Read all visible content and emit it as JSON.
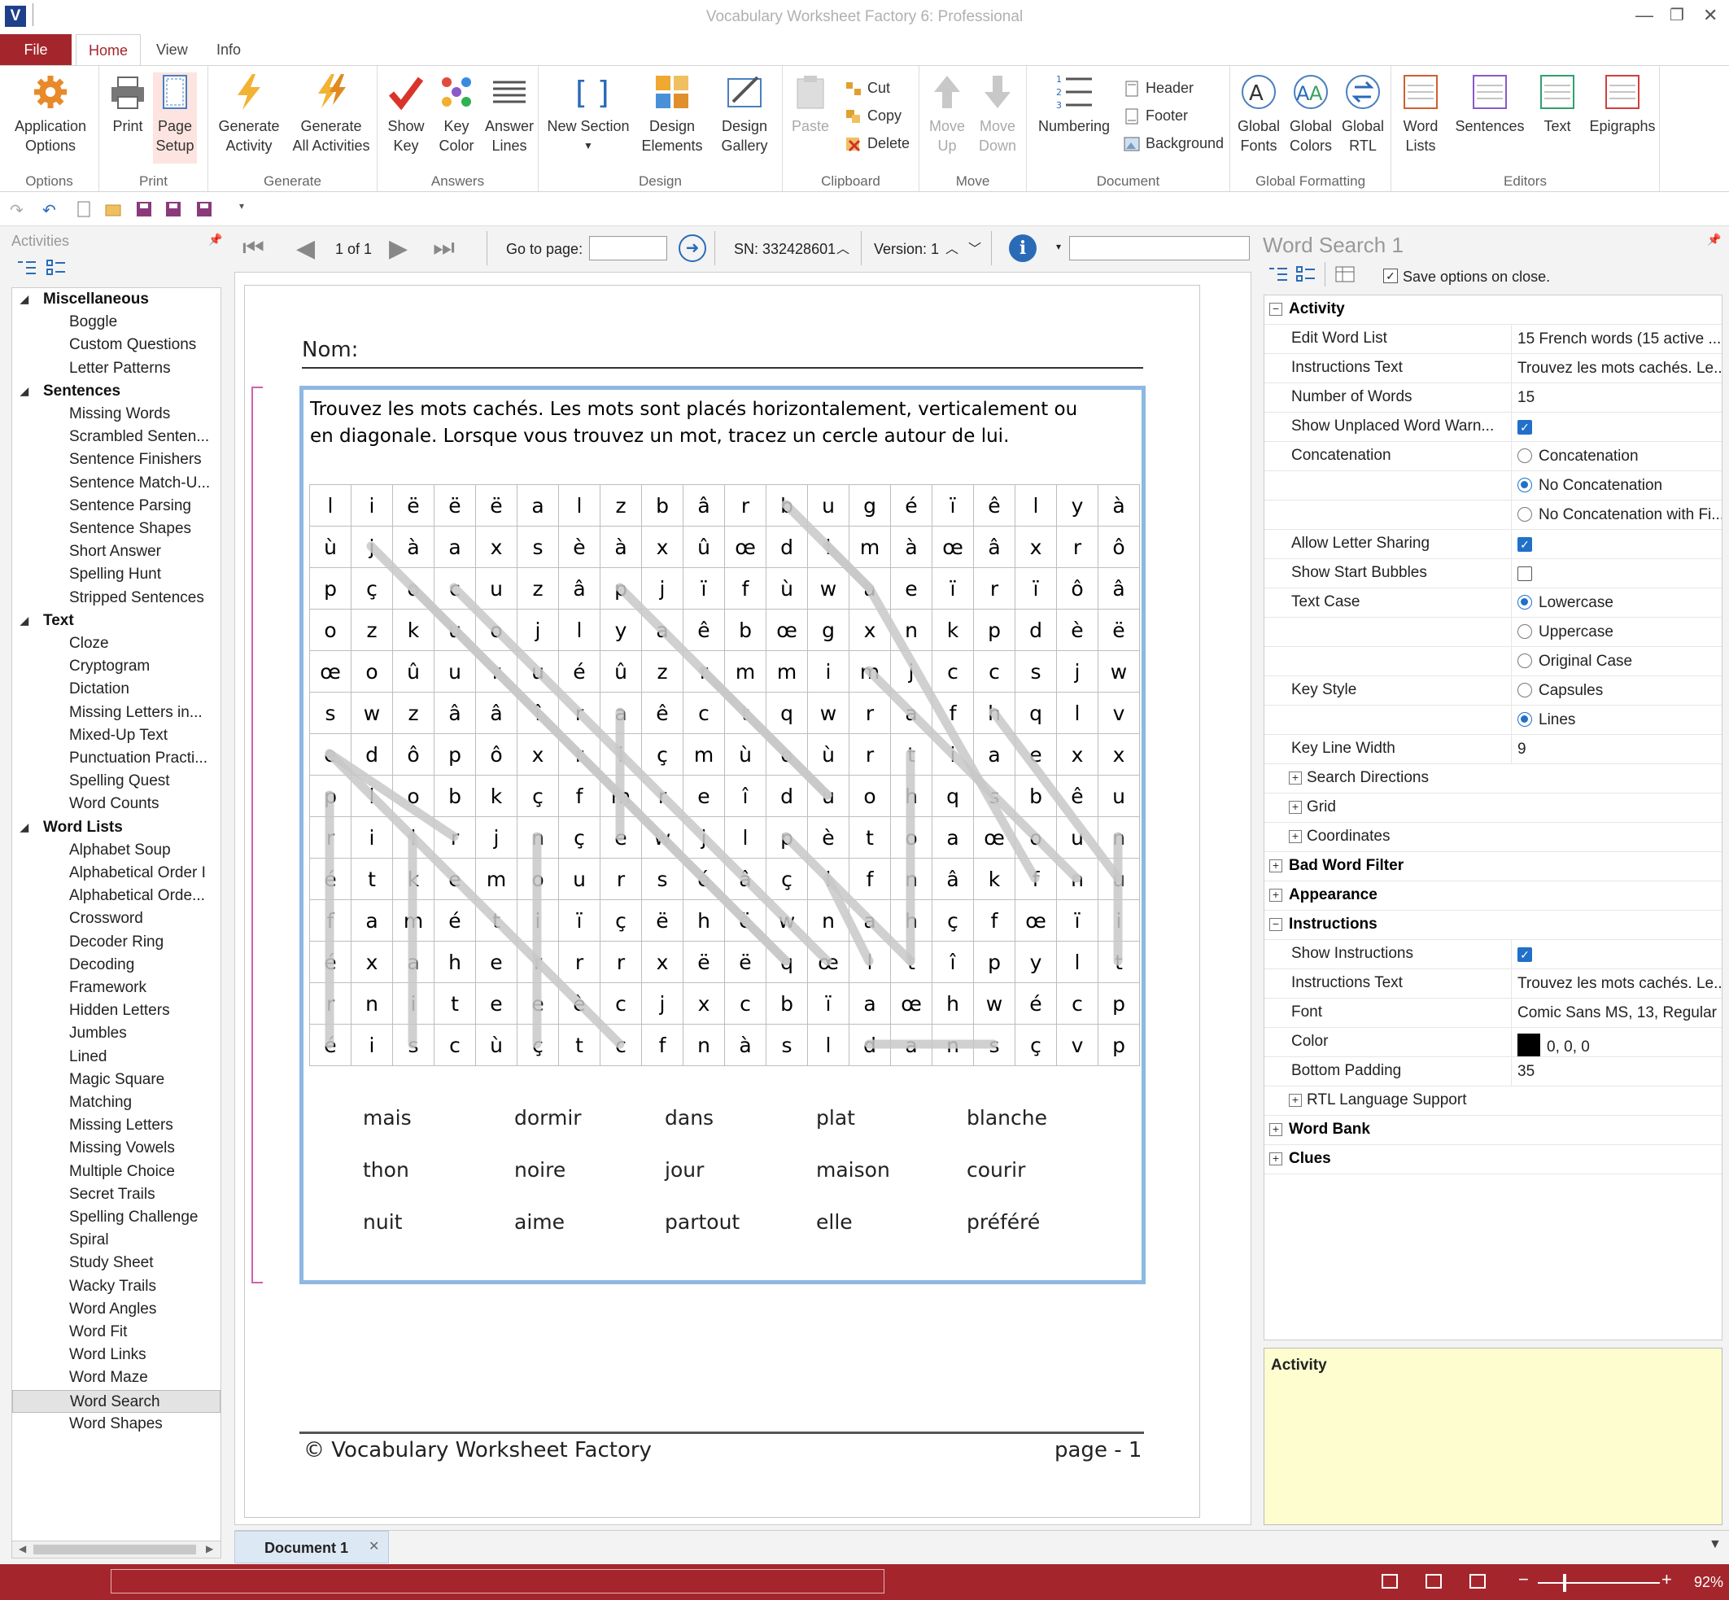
{
  "app": {
    "title": "Vocabulary Worksheet Factory 6: Professional",
    "logo": "V"
  },
  "tabs": [
    "File",
    "Home",
    "View",
    "Info"
  ],
  "ribbon": {
    "groups": [
      "Options",
      "Print",
      "Generate",
      "Answers",
      "Design",
      "Clipboard",
      "Move",
      "Document",
      "Global Formatting",
      "Editors"
    ],
    "buttons": {
      "application_options": "Application\nOptions",
      "print": "Print",
      "page_setup": "Page\nSetup",
      "generate_activity": "Generate\nActivity",
      "generate_all": "Generate\nAll Activities",
      "show_key": "Show\nKey",
      "key_color": "Key\nColor",
      "answer_lines": "Answer\nLines",
      "new_section": "New Section",
      "design_elements": "Design\nElements",
      "design_gallery": "Design\nGallery",
      "paste": "Paste",
      "cut": "Cut",
      "copy": "Copy",
      "delete": "Delete",
      "move_up": "Move\nUp",
      "move_down": "Move\nDown",
      "numbering": "Numbering",
      "header": "Header",
      "footer": "Footer",
      "background": "Background",
      "global_fonts": "Global\nFonts",
      "global_colors": "Global\nColors",
      "global_rtl": "Global\nRTL",
      "word_lists": "Word\nLists",
      "sentences": "Sentences",
      "text": "Text",
      "epigraphs": "Epigraphs"
    }
  },
  "left_panel": {
    "title": "Activities",
    "tree": [
      {
        "cat": "Miscellaneous",
        "items": [
          "Boggle",
          "Custom Questions",
          "Letter Patterns"
        ]
      },
      {
        "cat": "Sentences",
        "items": [
          "Missing Words",
          "Scrambled Senten...",
          "Sentence Finishers",
          "Sentence  Match-U...",
          "Sentence Parsing",
          "Sentence Shapes",
          "Short Answer",
          "Spelling Hunt",
          "Stripped Sentences"
        ]
      },
      {
        "cat": "Text",
        "items": [
          "Cloze",
          "Cryptogram",
          "Dictation",
          "Missing Letters in...",
          "Mixed-Up Text",
          "Punctuation  Practi...",
          "Spelling Quest",
          "Word Counts"
        ]
      },
      {
        "cat": "Word Lists",
        "items": [
          "Alphabet Soup",
          "Alphabetical Order I",
          "Alphabetical Orde...",
          "Crossword",
          "Decoder Ring",
          "Decoding",
          "Framework",
          "Hidden Letters",
          "Jumbles",
          "Lined",
          "Magic Square",
          "Matching",
          "Missing Letters",
          "Missing Vowels",
          "Multiple Choice",
          "Secret Trails",
          "Spelling Challenge",
          "Spiral",
          "Study Sheet",
          "Wacky Trails",
          "Word Angles",
          "Word Fit",
          "Word Links",
          "Word Maze",
          "Word Search",
          "Word Shapes"
        ]
      }
    ],
    "selected": "Word Search"
  },
  "doc_toolbar": {
    "page": "1 of 1",
    "goto_label": "Go to page:",
    "goto_value": "",
    "serial": "SN: 332428601",
    "version": "Version: 1"
  },
  "worksheet": {
    "name_label": "Nom:",
    "instructions": "Trouvez les mots cachés. Les mots sont placés horizontalement, verticalement ou en diagonale. Lorsque vous trouvez un mot, tracez un cercle autour de lui.",
    "grid": [
      [
        "l",
        "i",
        "ë",
        "ë",
        "ë",
        "a",
        "l",
        "z",
        "b",
        "â",
        "r",
        "b",
        "u",
        "g",
        "é",
        "ï",
        "ê",
        "l",
        "y",
        "à"
      ],
      [
        "ù",
        "j",
        "à",
        "a",
        "x",
        "s",
        "è",
        "à",
        "x",
        "û",
        "œ",
        "d",
        "l",
        "m",
        "à",
        "œ",
        "â",
        "x",
        "r",
        "ô"
      ],
      [
        "p",
        "ç",
        "o",
        "c",
        "u",
        "z",
        "â",
        "p",
        "j",
        "ï",
        "f",
        "ù",
        "w",
        "a",
        "e",
        "ï",
        "r",
        "ï",
        "ô",
        "â"
      ],
      [
        "o",
        "z",
        "k",
        "u",
        "o",
        "j",
        "l",
        "y",
        "a",
        "ê",
        "b",
        "œ",
        "g",
        "x",
        "n",
        "k",
        "p",
        "d",
        "è",
        "ë"
      ],
      [
        "œ",
        "o",
        "û",
        "u",
        "r",
        "u",
        "é",
        "û",
        "z",
        "r",
        "m",
        "m",
        "i",
        "m",
        "j",
        "c",
        "c",
        "s",
        "j",
        "w"
      ],
      [
        "s",
        "w",
        "z",
        "â",
        "â",
        "î",
        "r",
        "a",
        "ê",
        "c",
        "t",
        "q",
        "w",
        "r",
        "a",
        "f",
        "h",
        "q",
        "l",
        "v"
      ],
      [
        "e",
        "d",
        "ô",
        "p",
        "ô",
        "x",
        "r",
        "i",
        "ç",
        "m",
        "ù",
        "o",
        "ù",
        "r",
        "t",
        "i",
        "a",
        "e",
        "x",
        "x"
      ],
      [
        "p",
        "l",
        "o",
        "b",
        "k",
        "ç",
        "f",
        "m",
        "r",
        "e",
        "î",
        "d",
        "u",
        "o",
        "h",
        "q",
        "s",
        "b",
        "ê",
        "u"
      ],
      [
        "r",
        "i",
        "l",
        "r",
        "j",
        "n",
        "ç",
        "e",
        "w",
        "j",
        "l",
        "p",
        "è",
        "t",
        "o",
        "a",
        "œ",
        "o",
        "u",
        "n"
      ],
      [
        "é",
        "t",
        "k",
        "e",
        "m",
        "o",
        "u",
        "r",
        "s",
        "é",
        "â",
        "ç",
        "l",
        "f",
        "n",
        "â",
        "k",
        "f",
        "n",
        "u"
      ],
      [
        "f",
        "a",
        "m",
        "é",
        "t",
        "i",
        "ï",
        "ç",
        "ë",
        "h",
        "ë",
        "w",
        "n",
        "a",
        "h",
        "ç",
        "f",
        "œ",
        "ï",
        "i"
      ],
      [
        "é",
        "x",
        "a",
        "h",
        "e",
        "r",
        "r",
        "r",
        "x",
        "ë",
        "ë",
        "q",
        "œ",
        "l",
        "t",
        "î",
        "p",
        "y",
        "l",
        "t"
      ],
      [
        "r",
        "n",
        "i",
        "t",
        "e",
        "e",
        "è",
        "c",
        "j",
        "x",
        "c",
        "b",
        "ï",
        "a",
        "œ",
        "h",
        "w",
        "é",
        "c",
        "p"
      ],
      [
        "é",
        "i",
        "s",
        "c",
        "ù",
        "ç",
        "t",
        "c",
        "f",
        "n",
        "à",
        "s",
        "l",
        "d",
        "a",
        "n",
        "s",
        "ç",
        "v",
        "p"
      ]
    ],
    "word_bank": [
      [
        "mais",
        "dormir",
        "dans",
        "plat",
        "blanche"
      ],
      [
        "thon",
        "noire",
        "jour",
        "maison",
        "courir"
      ],
      [
        "nuit",
        "aime",
        "partout",
        "elle",
        "préféré"
      ]
    ],
    "footer_left": "© Vocabulary Worksheet Factory",
    "footer_right": "page - 1"
  },
  "right_panel": {
    "title": "Word Search 1",
    "save_option": "Save options on close.",
    "rows": [
      {
        "t": "sec",
        "label": "Activity",
        "exp": "−"
      },
      {
        "t": "val",
        "label": "Edit Word List",
        "value": "15 French words (15 active ..."
      },
      {
        "t": "val",
        "label": "Instructions Text",
        "value": "Trouvez les mots cachés. Le..."
      },
      {
        "t": "val",
        "label": "Number of Words",
        "value": "15"
      },
      {
        "t": "chk",
        "label": "Show Unplaced Word Warn...",
        "on": true
      },
      {
        "t": "rad",
        "label": "Concatenation",
        "value": "Concatenation",
        "on": false
      },
      {
        "t": "rad",
        "label": "",
        "value": "No Concatenation",
        "on": true
      },
      {
        "t": "rad",
        "label": "",
        "value": "No Concatenation with Fi...",
        "on": false
      },
      {
        "t": "chk",
        "label": "Allow Letter Sharing",
        "on": true
      },
      {
        "t": "chk",
        "label": "Show Start Bubbles",
        "on": false
      },
      {
        "t": "rad",
        "label": "Text Case",
        "value": "Lowercase",
        "on": true
      },
      {
        "t": "rad",
        "label": "",
        "value": "Uppercase",
        "on": false
      },
      {
        "t": "rad",
        "label": "",
        "value": "Original Case",
        "on": false
      },
      {
        "t": "rad",
        "label": "Key Style",
        "value": "Capsules",
        "on": false
      },
      {
        "t": "rad",
        "label": "",
        "value": "Lines",
        "on": true
      },
      {
        "t": "val",
        "label": "Key Line Width",
        "value": "9"
      },
      {
        "t": "sub",
        "label": "Search Directions"
      },
      {
        "t": "sub",
        "label": "Grid"
      },
      {
        "t": "sub",
        "label": "Coordinates"
      },
      {
        "t": "sec",
        "label": "Bad Word Filter",
        "exp": "+"
      },
      {
        "t": "sec",
        "label": "Appearance",
        "exp": "+"
      },
      {
        "t": "sec",
        "label": "Instructions",
        "exp": "−"
      },
      {
        "t": "chk",
        "label": "Show Instructions",
        "on": true
      },
      {
        "t": "val",
        "label": "Instructions Text",
        "value": "Trouvez les mots cachés. Le..."
      },
      {
        "t": "val",
        "label": "Font",
        "value": "Comic Sans MS, 13, Regular"
      },
      {
        "t": "color",
        "label": "Color",
        "value": "0, 0, 0"
      },
      {
        "t": "val",
        "label": "Bottom Padding",
        "value": "35"
      },
      {
        "t": "sub",
        "label": "RTL Language Support"
      },
      {
        "t": "sec",
        "label": "Word Bank",
        "exp": "+"
      },
      {
        "t": "sec",
        "label": "Clues",
        "exp": "+"
      }
    ],
    "help_title": "Activity"
  },
  "doc_tab": "Document 1",
  "status": {
    "zoom": "92%"
  },
  "colors": {
    "accent": "#a4262c",
    "grid_border": "#8db8e2",
    "key_line": "#c8c8c8",
    "help_bg": "#fefdd0"
  }
}
